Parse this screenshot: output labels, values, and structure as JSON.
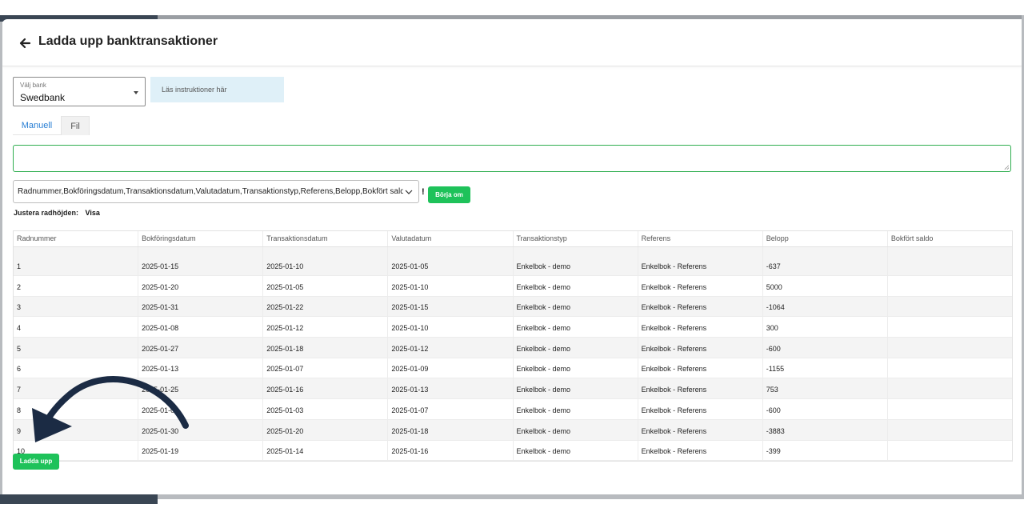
{
  "header": {
    "title": "Ladda upp banktransaktioner"
  },
  "bank_select": {
    "label": "Välj bank",
    "value": "Swedbank"
  },
  "instructions": {
    "text": "Läs instruktioner här"
  },
  "tabs": [
    {
      "label": "Manuell"
    },
    {
      "label": "Fil"
    }
  ],
  "columns_select": {
    "value": "Radnummer,Bokföringsdatum,Transaktionsdatum,Valutadatum,Transaktionstyp,Referens,Belopp,Bokfört saldo"
  },
  "warning_mark": "!",
  "borja_om_label": "Börja om",
  "row_height": {
    "label": "Justera radhöjden:",
    "link": "Visa"
  },
  "table": {
    "headers": [
      "Radnummer",
      "Bokföringsdatum",
      "Transaktionsdatum",
      "Valutadatum",
      "Transaktionstyp",
      "Referens",
      "Belopp",
      "Bokfört saldo"
    ],
    "rows": [
      [
        "1",
        "2025-01-15",
        "2025-01-10",
        "2025-01-05",
        "Enkelbok - demo",
        "Enkelbok - Referens",
        "-637",
        ""
      ],
      [
        "2",
        "2025-01-20",
        "2025-01-05",
        "2025-01-10",
        "Enkelbok - demo",
        "Enkelbok - Referens",
        "5000",
        ""
      ],
      [
        "3",
        "2025-01-31",
        "2025-01-22",
        "2025-01-15",
        "Enkelbok - demo",
        "Enkelbok - Referens",
        "-1064",
        ""
      ],
      [
        "4",
        "2025-01-08",
        "2025-01-12",
        "2025-01-10",
        "Enkelbok - demo",
        "Enkelbok - Referens",
        "300",
        ""
      ],
      [
        "5",
        "2025-01-27",
        "2025-01-18",
        "2025-01-12",
        "Enkelbok - demo",
        "Enkelbok - Referens",
        "-600",
        ""
      ],
      [
        "6",
        "2025-01-13",
        "2025-01-07",
        "2025-01-09",
        "Enkelbok - demo",
        "Enkelbok - Referens",
        "-1155",
        ""
      ],
      [
        "7",
        "2025-01-25",
        "2025-01-16",
        "2025-01-13",
        "Enkelbok - demo",
        "Enkelbok - Referens",
        "753",
        ""
      ],
      [
        "8",
        "2025-01-09",
        "2025-01-03",
        "2025-01-07",
        "Enkelbok - demo",
        "Enkelbok - Referens",
        "-600",
        ""
      ],
      [
        "9",
        "2025-01-30",
        "2025-01-20",
        "2025-01-18",
        "Enkelbok - demo",
        "Enkelbok - Referens",
        "-3883",
        ""
      ],
      [
        "10",
        "2025-01-19",
        "2025-01-14",
        "2025-01-16",
        "Enkelbok - demo",
        "Enkelbok - Referens",
        "-399",
        ""
      ]
    ]
  },
  "upload_button": {
    "label": "Ladda upp"
  },
  "colors": {
    "accent_green": "#1ec25a",
    "tab_blue": "#2a7fd4",
    "info_bg": "#dff0f8",
    "arrow": "#1b2b44"
  },
  "icons": {
    "back": "arrow-left-icon",
    "dropdown": "caret-down-icon",
    "chevron": "chevron-down-icon",
    "annotation": "curved-arrow-icon"
  }
}
